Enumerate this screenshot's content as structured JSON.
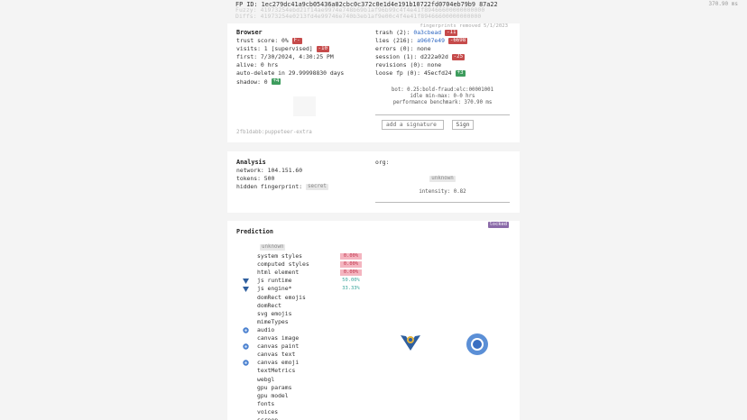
{
  "header": {
    "fp_id_label": "FP ID:",
    "fp_id": "1ec279dc41a9cb05436a82cbc0c372c0e1d4e191b10722fd0704eb79b9 87a22",
    "fuzzy_label": "Fuzzy:",
    "fuzzy": "41973254ebd21f14ae9974e748b69b1af96b99c4f4e41f89466600000000000",
    "diffs_label": "Diffs:",
    "diffs": "41973254e0213fd4e99746e740b3eb1af9e00c4f4e41f89466600000000000",
    "perf": "370.90 ms"
  },
  "browser": {
    "title": "Browser",
    "trust_score": "trust score: 0%",
    "trust_chip": "F-",
    "visits": "visits: 1 [supervised]",
    "visits_chip": "-10",
    "first": "first: 7/30/2024, 4:30:25 PM",
    "alive": "alive: 0 hrs",
    "auto_delete": "auto-delete in 29.99998830 days",
    "shadow": "shadow: 0",
    "shadow_chip": "+4",
    "hash_footer": "2fb1dabb:puppeteer-extra"
  },
  "browser_right": {
    "fp_removed": "fingerprints removed 5/1/2023",
    "trash": "trash (2):",
    "trash_hash": "0a3cbead",
    "trash_chip": "-11",
    "lies": "lies (216):",
    "lies_hash": "a9607e49",
    "lies_chip": "-6698",
    "errors": "errors (0): none",
    "session": "session (1): d222a02d",
    "session_chip": "-25",
    "revisions": "revisions (0): none",
    "loose": "loose fp (0): 45ecfd24",
    "loose_chip": "+3",
    "bot_line1": "bot: 0.25:bold-fraud:elc:00001001",
    "bot_line2": "idle min-max: 0-0 hrs",
    "bot_line3": "performance benchmark: 370.90 ms",
    "signature_placeholder": "add a signature",
    "sign_label": "Sign"
  },
  "analysis": {
    "title": "Analysis",
    "network": "network: 104.151.60",
    "tokens": "tokens: 500",
    "hidden": "hidden fingerprint:",
    "hidden_chip": "secret",
    "org": "org:",
    "unknown": "unknown",
    "intensity": "intensity: 0.82"
  },
  "prediction": {
    "title": "Prediction",
    "locked": "locked",
    "unknown": "unknown",
    "rows": [
      {
        "label": "system styles",
        "pct": "0.00%",
        "pct_style": "red",
        "icon": ""
      },
      {
        "label": "computed styles",
        "pct": "0.00%",
        "pct_style": "red",
        "icon": ""
      },
      {
        "label": "html element",
        "pct": "0.00%",
        "pct_style": "red",
        "icon": ""
      },
      {
        "label": "js runtime",
        "pct": "50.00%",
        "pct_style": "teal",
        "icon": "triangle"
      },
      {
        "label": "js engine*",
        "pct": "33.33%",
        "pct_style": "teal",
        "icon": "triangle"
      },
      {
        "label": "domRect emojis",
        "pct": "",
        "pct_style": "",
        "icon": ""
      },
      {
        "label": "domRect",
        "pct": "",
        "pct_style": "",
        "icon": ""
      },
      {
        "label": "svg emojis",
        "pct": "",
        "pct_style": "",
        "icon": ""
      },
      {
        "label": "mimeTypes",
        "pct": "",
        "pct_style": "",
        "icon": ""
      },
      {
        "label": "audio",
        "pct": "",
        "pct_style": "",
        "icon": "circle"
      },
      {
        "label": "canvas image",
        "pct": "",
        "pct_style": "",
        "icon": ""
      },
      {
        "label": "canvas paint",
        "pct": "",
        "pct_style": "",
        "icon": "circle"
      },
      {
        "label": "canvas text",
        "pct": "",
        "pct_style": "",
        "icon": ""
      },
      {
        "label": "canvas emoji",
        "pct": "",
        "pct_style": "",
        "icon": "circle"
      },
      {
        "label": "textMetrics",
        "pct": "",
        "pct_style": "",
        "icon": ""
      },
      {
        "label": "webgl",
        "pct": "",
        "pct_style": "",
        "icon": ""
      },
      {
        "label": "gpu params",
        "pct": "",
        "pct_style": "",
        "icon": ""
      },
      {
        "label": "gpu model",
        "pct": "",
        "pct_style": "",
        "icon": ""
      },
      {
        "label": "fonts",
        "pct": "",
        "pct_style": "",
        "icon": ""
      },
      {
        "label": "voices",
        "pct": "",
        "pct_style": "",
        "icon": ""
      },
      {
        "label": "screen",
        "pct": "",
        "pct_style": "",
        "icon": ""
      }
    ]
  },
  "colors": {
    "red_chip": "#c64b4b",
    "green_chip": "#3d9c5d",
    "link": "#2c66c1",
    "locked": "#8a6aa8"
  }
}
